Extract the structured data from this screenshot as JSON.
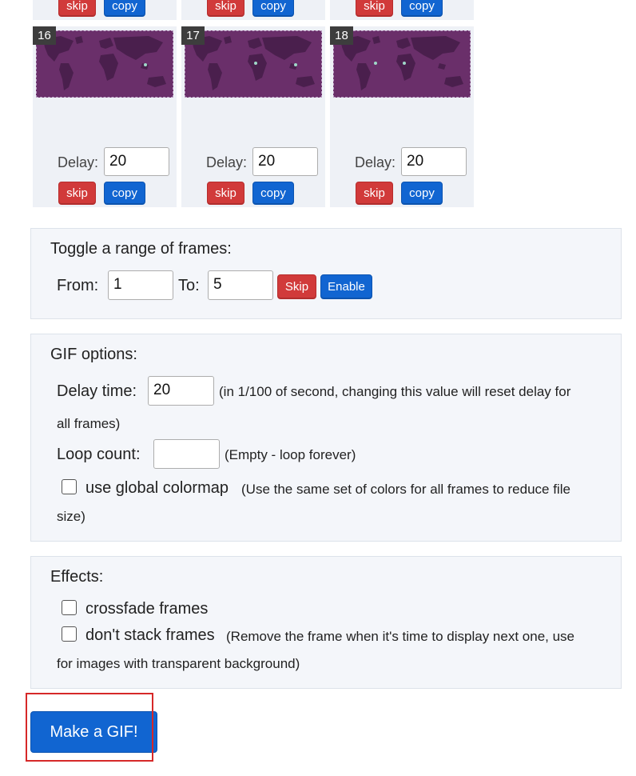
{
  "top_frames": [
    {
      "skip": "skip",
      "copy": "copy"
    },
    {
      "skip": "skip",
      "copy": "copy"
    },
    {
      "skip": "skip",
      "copy": "copy"
    }
  ],
  "frames": [
    {
      "number": "16",
      "delay_label": "Delay:",
      "delay_value": "20",
      "skip": "skip",
      "copy": "copy"
    },
    {
      "number": "17",
      "delay_label": "Delay:",
      "delay_value": "20",
      "skip": "skip",
      "copy": "copy"
    },
    {
      "number": "18",
      "delay_label": "Delay:",
      "delay_value": "20",
      "skip": "skip",
      "copy": "copy"
    }
  ],
  "toggle_range": {
    "title": "Toggle a range of frames:",
    "from_label": "From:",
    "from_value": "1",
    "to_label": "To:",
    "to_value": "5",
    "skip_label": "Skip",
    "enable_label": "Enable"
  },
  "gif_options": {
    "title": "GIF options:",
    "delay_label": "Delay time:",
    "delay_value": "20",
    "delay_note_1": "(in 1/100 of second, changing this value will reset delay for",
    "delay_note_2": "all frames)",
    "loop_label": "Loop count:",
    "loop_value": "",
    "loop_note": "(Empty - loop forever)",
    "colormap_label": "use global colormap",
    "colormap_note_1": "(Use the same set of colors for all frames to reduce file",
    "colormap_note_2": "size)"
  },
  "effects": {
    "title": "Effects:",
    "crossfade_label": "crossfade frames",
    "nostack_label": "don't stack frames",
    "nostack_note_1": "(Remove the frame when it's time to display next one, use",
    "nostack_note_2": "for images with transparent background)"
  },
  "make_gif_label": "Make a GIF!",
  "colors": {
    "skip": "#d13a3a",
    "copy": "#1165d1",
    "highlight": "#d62828",
    "map_background": "#6a2f6a"
  }
}
